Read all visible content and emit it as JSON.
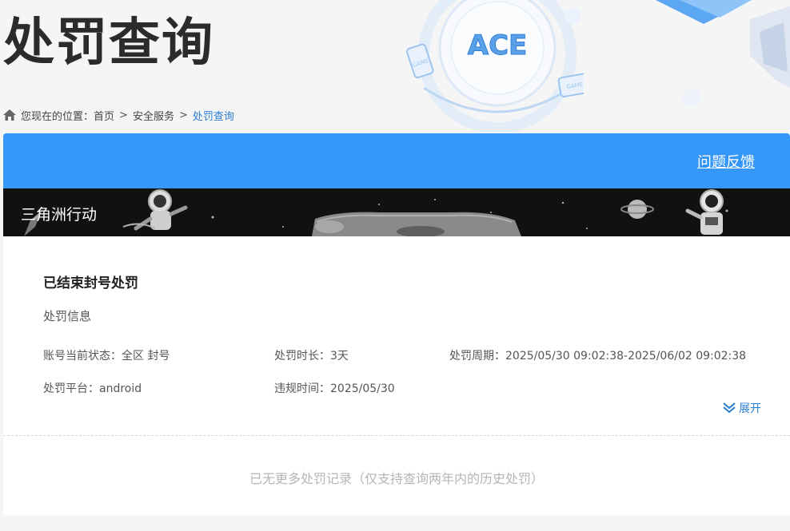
{
  "page": {
    "title": "处罚查询"
  },
  "breadcrumb": {
    "prefix": "您现在的位置：",
    "items": [
      "首页",
      "安全服务",
      "处罚查询"
    ],
    "separator": ">"
  },
  "header": {
    "logo_text": "ACE",
    "feedback_label": "问题反馈"
  },
  "banner": {
    "game_name": "三角洲行动"
  },
  "record": {
    "title": "已结束封号处罚",
    "section_label": "处罚信息",
    "fields": [
      {
        "label": "账号当前状态：",
        "value": "全区 封号"
      },
      {
        "label": "处罚时长：",
        "value": "3天"
      },
      {
        "label": "处罚周期：",
        "value": "2025/05/30 09:02:38-2025/06/02 09:02:38"
      },
      {
        "label": "处罚平台：",
        "value": "android"
      },
      {
        "label": "违规时间：",
        "value": "2025/05/30"
      }
    ],
    "expand_label": "展开"
  },
  "footer": {
    "no_more_text": "已无更多处罚记录（仅支持查询两年内的历史处罚）"
  },
  "colors": {
    "accent": "#3597f7",
    "link": "#2a7fd4",
    "banner_bg": "#111111"
  }
}
